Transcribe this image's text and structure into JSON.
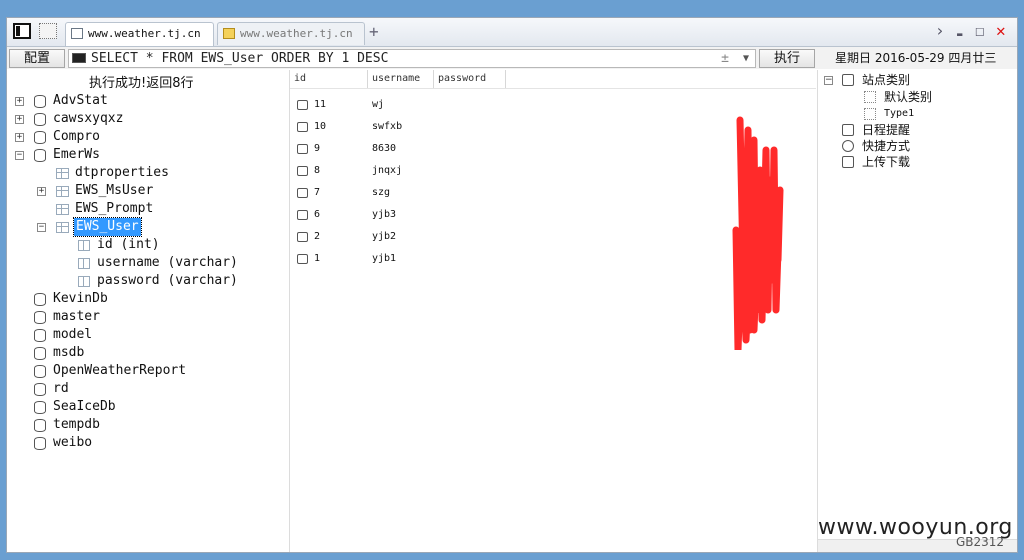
{
  "tabs": [
    {
      "label": "www.weather.tj.cn",
      "active": true
    },
    {
      "label": "www.weather.tj.cn",
      "active": false
    }
  ],
  "new_tab": "+",
  "window_controls": {
    "forward": "›",
    "minimize": "▬",
    "maximize": "☐",
    "close": "✕"
  },
  "toolbar": {
    "config_label": "配置",
    "sql": "SELECT * FROM EWS_User ORDER BY 1 DESC",
    "pm": "±",
    "dropdown": "▼",
    "execute_label": "执行",
    "date": "星期日  2016-05-29  四月廿三"
  },
  "status": "执行成功!返回8行",
  "tree": {
    "databases": [
      "AdvStat",
      "cawsxyqxz",
      "Compro",
      "EmerWs",
      "KevinDb",
      "master",
      "model",
      "msdb",
      "OpenWeatherReport",
      "rd",
      "SeaIceDb",
      "tempdb",
      "weibo"
    ],
    "emerws_children": [
      "dtproperties",
      "EWS_MsUser",
      "EWS_Prompt",
      "EWS_User"
    ],
    "columns": [
      "id (int)",
      "username (varchar)",
      "password (varchar)"
    ]
  },
  "results": {
    "headers": [
      "id",
      "username",
      "password"
    ],
    "rows": [
      {
        "id": "11",
        "username": "wj"
      },
      {
        "id": "10",
        "username": "swfxb"
      },
      {
        "id": "9",
        "username": "8630"
      },
      {
        "id": "8",
        "username": "jnqxj"
      },
      {
        "id": "7",
        "username": "szg"
      },
      {
        "id": "6",
        "username": "yjb3"
      },
      {
        "id": "2",
        "username": "yjb2"
      },
      {
        "id": "1",
        "username": "yjb1"
      }
    ]
  },
  "right_tree": {
    "root": "站点类别",
    "children": [
      "默认类别",
      "Type1"
    ],
    "items": [
      "日程提醒",
      "快捷方式",
      "上传下载"
    ]
  },
  "watermark": "www.wooyun.org",
  "encoding": "GB2312",
  "colors": {
    "selection": "#3399ff",
    "redaction": "#ff2a2a",
    "close": "#dd1111"
  }
}
